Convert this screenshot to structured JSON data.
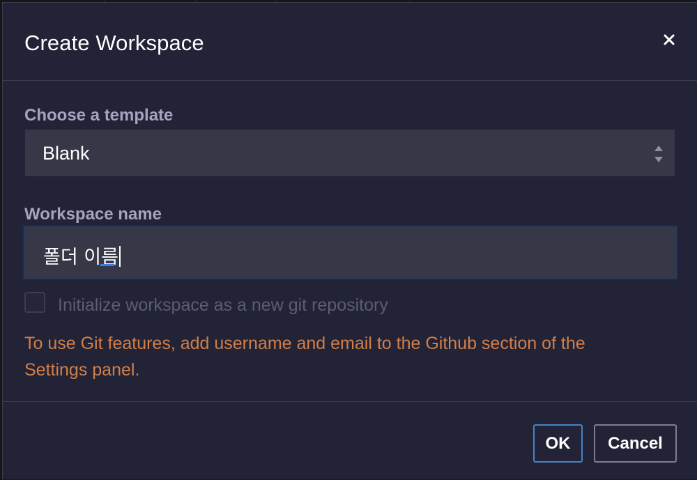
{
  "dialog": {
    "title": "Create Workspace",
    "close_icon": "close-icon"
  },
  "template": {
    "label": "Choose a template",
    "selected": "Blank",
    "arrows_icon": "select-updown-arrows-icon"
  },
  "workspace_name": {
    "label": "Workspace name",
    "value": "폴더 이름"
  },
  "git": {
    "checkbox_label": "Initialize workspace as a new git repository",
    "checked": false,
    "warning": "To use Git features, add username and email to the Github section of the Settings panel."
  },
  "footer": {
    "ok_label": "OK",
    "cancel_label": "Cancel"
  },
  "colors": {
    "dialog_bg": "#222336",
    "field_bg": "#363847",
    "label": "#a4a4c0",
    "warning": "#d17f48",
    "ok_border": "#4683c4",
    "cancel_border": "#7e7f8e"
  }
}
